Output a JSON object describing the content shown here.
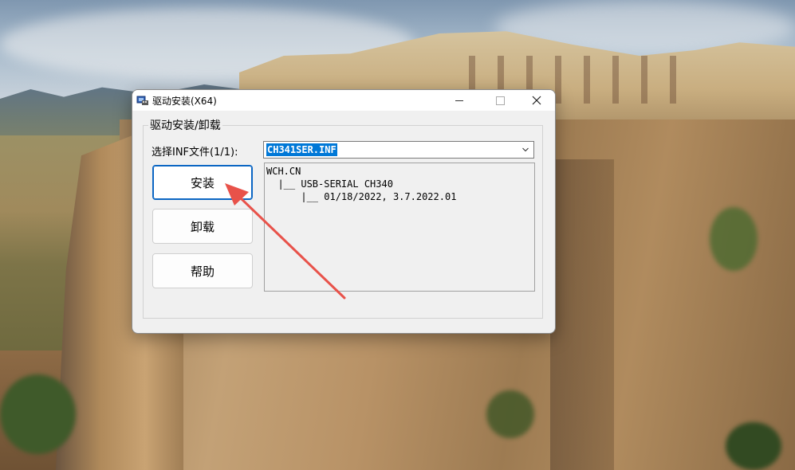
{
  "window": {
    "title": "驱动安装(X64)",
    "group_title": "驱动安装/卸载",
    "select_label": "选择INF文件(1/1):",
    "inf_selected": "CH341SER.INF",
    "buttons": {
      "install": "安装",
      "uninstall": "卸载",
      "help": "帮助"
    },
    "tree_lines": [
      "WCH.CN",
      "  |__ USB-SERIAL CH340",
      "      |__ 01/18/2022, 3.7.2022.01"
    ],
    "controls": {
      "minimize": "—",
      "maximize": "☐",
      "close": "✕"
    }
  },
  "colors": {
    "selection": "#0078d7",
    "annotation_arrow": "#e8524a",
    "window_bg": "#f0f0f0"
  },
  "icons": {
    "app": "driver-installer-icon",
    "combo_dropdown": "chevron-down-icon"
  }
}
